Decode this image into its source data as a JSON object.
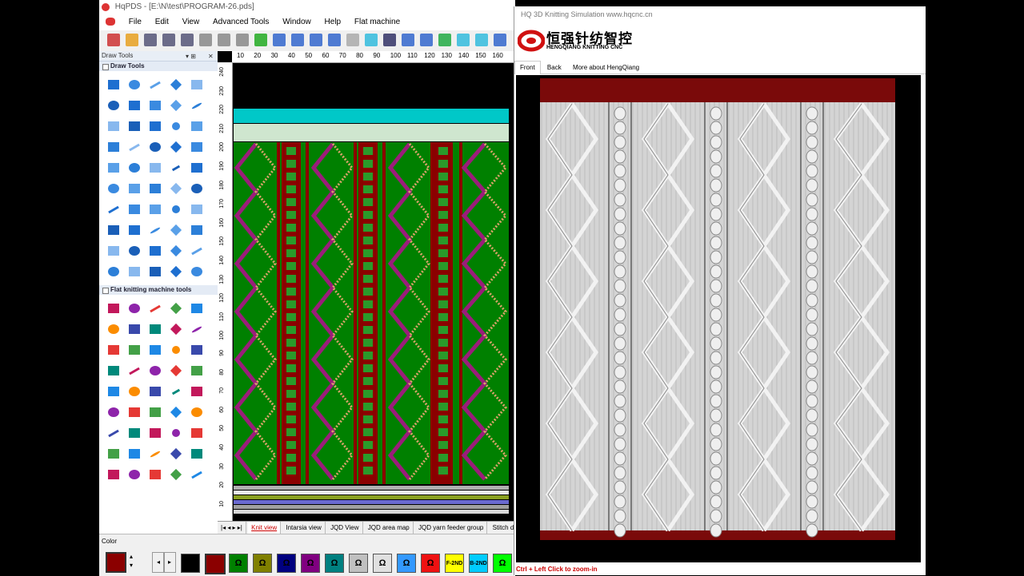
{
  "app": {
    "title": "HqPDS - [E:\\N\\test\\PROGRAM-26.pds]",
    "menu": [
      "File",
      "Edit",
      "View",
      "Advanced Tools",
      "Window",
      "Help",
      "Flat machine"
    ]
  },
  "draw_panel": {
    "title": "Draw Tools",
    "sections": [
      "Draw Tools",
      "Flat knitting machine tools"
    ]
  },
  "ruler": {
    "h": [
      "10",
      "20",
      "30",
      "40",
      "50",
      "60",
      "70",
      "80",
      "90",
      "100",
      "110",
      "120",
      "130",
      "140",
      "150",
      "160"
    ],
    "v": [
      "240",
      "230",
      "220",
      "210",
      "200",
      "190",
      "180",
      "170",
      "160",
      "150",
      "140",
      "130",
      "120",
      "110",
      "100",
      "90",
      "80",
      "70",
      "60",
      "50",
      "40",
      "30",
      "20",
      "10"
    ]
  },
  "view_tabs": [
    "Knit view",
    "Intarsia view",
    "JQD View",
    "JQD area map",
    "JQD yarn feeder group",
    "Stitch d"
  ],
  "active_tab": "Knit view",
  "color_panel": {
    "label": "Color",
    "swatches": [
      {
        "color": "#000000",
        "label": ""
      },
      {
        "color": "#8b0000",
        "label": ""
      },
      {
        "color": "#008000",
        "label": ""
      },
      {
        "color": "#808000",
        "label": ""
      },
      {
        "color": "#000080",
        "label": ""
      },
      {
        "color": "#800080",
        "label": ""
      },
      {
        "color": "#008080",
        "label": ""
      },
      {
        "color": "#c0c0c0",
        "label": ""
      },
      {
        "color": "#e0e0e0",
        "label": ""
      },
      {
        "color": "#3399ff",
        "label": ""
      },
      {
        "color": "#ee1111",
        "label": ""
      },
      {
        "color": "#ffff00",
        "label": "F-2ND"
      },
      {
        "color": "#00ccff",
        "label": "B-2ND"
      },
      {
        "color": "#00ff00",
        "label": ""
      }
    ]
  },
  "simulation": {
    "title": "HQ 3D Knitting Simulation    www.hqcnc.cn",
    "logo_cn": "恒强针纺智控",
    "logo_en": "HENGQIANG KNITTING CNC",
    "tabs": [
      "Front",
      "Back",
      "More about HengQiang"
    ],
    "hint": "Ctrl + Left Click to zoom-in"
  },
  "colors": {
    "green": "#008000",
    "maroon": "#8b0000",
    "cyan": "#00c8c8",
    "purple": "#9b1d7a",
    "knit_bg": "#d4d4d4",
    "sim_red": "#7a0a0a"
  }
}
